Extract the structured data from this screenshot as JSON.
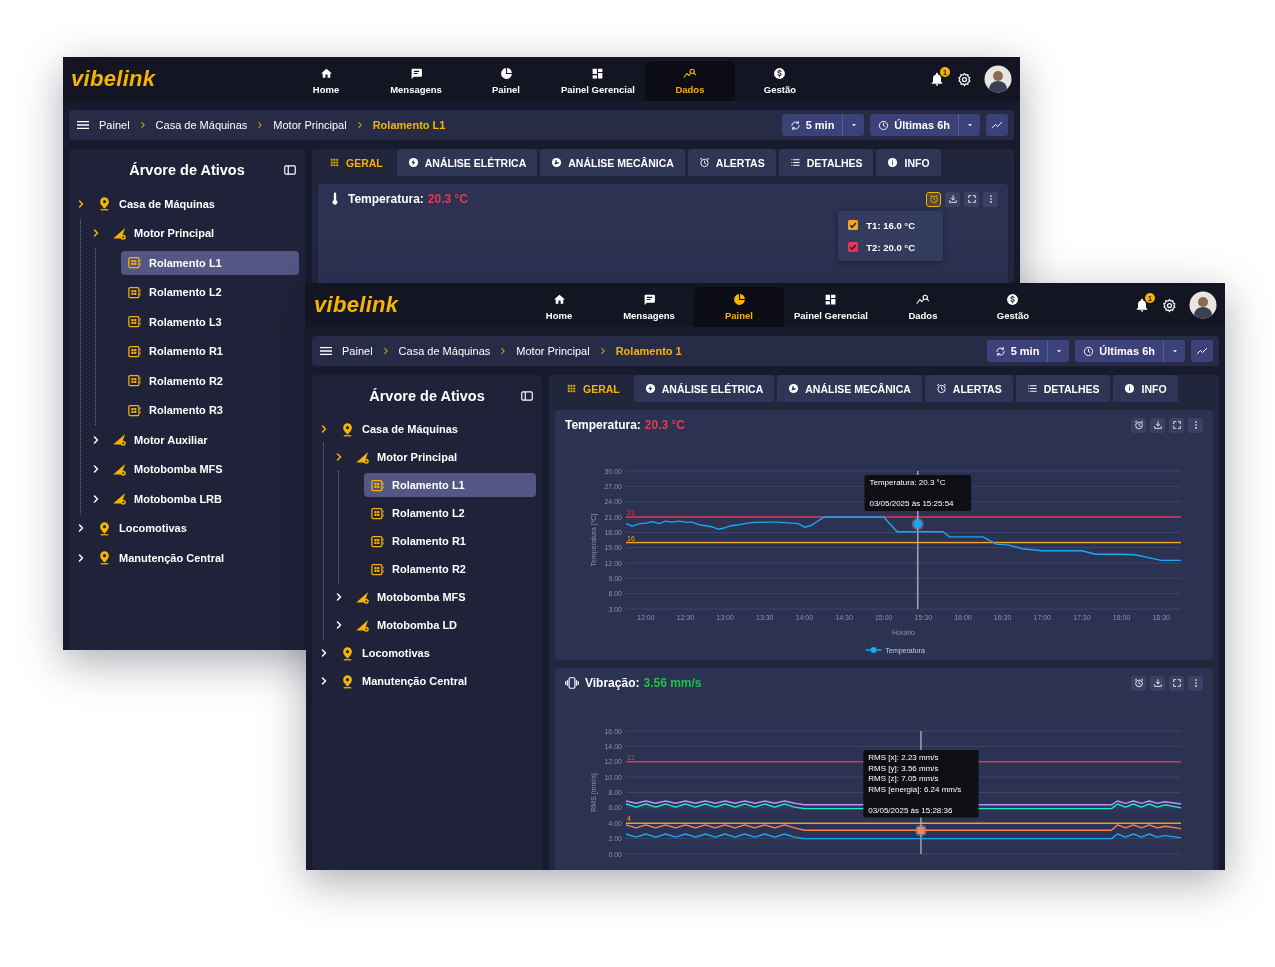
{
  "windows": [
    {
      "logo": "vibelink",
      "nav": [
        {
          "label": "Home",
          "selected": false
        },
        {
          "label": "Mensagens",
          "selected": false
        },
        {
          "label": "Painel",
          "selected": false
        },
        {
          "label": "Painel Gerencial",
          "selected": false
        },
        {
          "label": "Dados",
          "selected": true
        },
        {
          "label": "Gestão",
          "selected": false
        }
      ],
      "notification_count": "1",
      "breadcrumb": [
        "Painel",
        "Casa de Máquinas",
        "Motor Principal",
        "Rolamento L1"
      ],
      "refresh": "5 min",
      "range": "Últimas 6h",
      "sidebar": {
        "title": "Árvore de Ativos",
        "tree": [
          {
            "label": "Casa de Máquinas",
            "kind": "location",
            "selected": false,
            "expanded": true,
            "children": [
              {
                "label": "Motor Principal",
                "kind": "machine",
                "selected": false,
                "expanded": true,
                "children": [
                  {
                    "label": "Rolamento L1",
                    "kind": "bearing",
                    "selected": true
                  },
                  {
                    "label": "Rolamento L2",
                    "kind": "bearing",
                    "selected": false
                  },
                  {
                    "label": "Rolamento L3",
                    "kind": "bearing",
                    "selected": false
                  },
                  {
                    "label": "Rolamento R1",
                    "kind": "bearing",
                    "selected": false
                  },
                  {
                    "label": "Rolamento R2",
                    "kind": "bearing",
                    "selected": false
                  },
                  {
                    "label": "Rolamento R3",
                    "kind": "bearing",
                    "selected": false
                  }
                ]
              },
              {
                "label": "Motor Auxiliar",
                "kind": "machine",
                "selected": false,
                "expanded": false
              },
              {
                "label": "Motobomba MFS",
                "kind": "machine",
                "selected": false,
                "expanded": false
              },
              {
                "label": "Motobomba LRB",
                "kind": "machine",
                "selected": false,
                "expanded": false
              }
            ]
          },
          {
            "label": "Locomotivas",
            "kind": "location",
            "selected": false,
            "expanded": false
          },
          {
            "label": "Manutenção Central",
            "kind": "location",
            "selected": false,
            "expanded": false
          }
        ]
      },
      "tabs": [
        {
          "label": "GERAL",
          "selected": true
        },
        {
          "label": "ANÁLISE ELÉTRICA",
          "selected": false
        },
        {
          "label": "ANÁLISE MECÂNICA",
          "selected": false
        },
        {
          "label": "ALERTAS",
          "selected": false
        },
        {
          "label": "DETALHES",
          "selected": false
        },
        {
          "label": "INFO",
          "selected": false
        }
      ],
      "cards": [
        {
          "kind": "temperature",
          "title": "Temperatura:",
          "value": "20.3 °C",
          "color": "#e8374f",
          "threshold_menu": [
            {
              "label": "T1: 16.0 °C",
              "checked": true,
              "color": "#f5a623"
            },
            {
              "label": "T2: 20.0 °C",
              "checked": true,
              "color": "#e8374f"
            }
          ]
        }
      ]
    },
    {
      "logo": "vibelink",
      "nav": [
        {
          "label": "Home",
          "selected": false
        },
        {
          "label": "Mensagens",
          "selected": false
        },
        {
          "label": "Painel",
          "selected": true
        },
        {
          "label": "Painel Gerencial",
          "selected": false
        },
        {
          "label": "Dados",
          "selected": false
        },
        {
          "label": "Gestão",
          "selected": false
        }
      ],
      "notification_count": "1",
      "breadcrumb": [
        "Painel",
        "Casa de Máquinas",
        "Motor Principal",
        "Rolamento 1"
      ],
      "refresh": "5 min",
      "range": "Últimas 6h",
      "sidebar": {
        "title": "Árvore de Ativos",
        "tree": [
          {
            "label": "Casa de Máquinas",
            "kind": "location",
            "selected": false,
            "expanded": true,
            "children": [
              {
                "label": "Motor Principal",
                "kind": "machine",
                "selected": false,
                "expanded": true,
                "children": [
                  {
                    "label": "Rolamento L1",
                    "kind": "bearing",
                    "selected": true
                  },
                  {
                    "label": "Rolamento L2",
                    "kind": "bearing",
                    "selected": false
                  },
                  {
                    "label": "Rolamento R1",
                    "kind": "bearing",
                    "selected": false
                  },
                  {
                    "label": "Rolamento R2",
                    "kind": "bearing",
                    "selected": false
                  }
                ]
              },
              {
                "label": "Motobomba MFS",
                "kind": "machine",
                "selected": false,
                "expanded": false
              },
              {
                "label": "Motobomba LD",
                "kind": "machine",
                "selected": false,
                "expanded": false
              }
            ]
          },
          {
            "label": "Locomotivas",
            "kind": "location",
            "selected": false,
            "expanded": false
          },
          {
            "label": "Manutenção Central",
            "kind": "location",
            "selected": false,
            "expanded": false
          }
        ]
      },
      "tabs": [
        {
          "label": "GERAL",
          "selected": true
        },
        {
          "label": "ANÁLISE ELÉTRICA",
          "selected": false
        },
        {
          "label": "ANÁLISE MECÂNICA",
          "selected": false
        },
        {
          "label": "ALERTAS",
          "selected": false
        },
        {
          "label": "DETALHES",
          "selected": false
        },
        {
          "label": "INFO",
          "selected": false
        }
      ],
      "cards": [
        {
          "title": "Temperatura:",
          "value": "20.3 °C",
          "color": "#e8374f",
          "legend": true,
          "chart_data": {
            "type": "line",
            "xlabel": "Horário",
            "ylabel": "Temperatura [ºC]",
            "xlim": [
              11.75,
              18.75
            ],
            "ylim": [
              3,
              30
            ],
            "grid": true,
            "x": [
              11.75,
              11.83,
              11.92,
              12.0,
              12.08,
              12.17,
              12.25,
              12.33,
              12.42,
              12.5,
              12.58,
              12.67,
              12.75,
              12.83,
              12.92,
              13.0,
              13.08,
              13.17,
              13.25,
              13.33,
              13.5,
              13.67,
              13.83,
              13.92,
              14.0,
              14.08,
              14.25,
              15.0,
              15.17,
              15.75,
              15.83,
              16.25,
              16.42,
              16.58,
              16.75,
              17.0,
              17.5,
              17.67,
              18.0,
              18.17,
              18.5,
              18.75
            ],
            "series": [
              {
                "name": "Temperatura",
                "color": "#1ea7f0",
                "values": [
                  19.7,
                  19.2,
                  19.7,
                  19.8,
                  20.1,
                  19.7,
                  20.2,
                  20.0,
                  20.2,
                  20.0,
                  20.0,
                  19.5,
                  19.3,
                  19.1,
                  18.6,
                  18.9,
                  19.3,
                  19.5,
                  19.7,
                  19.9,
                  20.0,
                  20.0,
                  19.8,
                  19.7,
                  19.0,
                  19.3,
                  21.0,
                  21.0,
                  18.1,
                  18.1,
                  17.1,
                  17.1,
                  15.7,
                  15.5,
                  14.8,
                  14.4,
                  14.4,
                  13.7,
                  13.7,
                  13.6,
                  12.5,
                  12.5
                ]
              }
            ],
            "xticks": [
              {
                "value": 12,
                "label": "12:00"
              },
              {
                "value": 12.5,
                "label": "12:30"
              },
              {
                "value": 13,
                "label": "13:00"
              },
              {
                "value": 13.5,
                "label": "13:30"
              },
              {
                "value": 14,
                "label": "14:00"
              },
              {
                "value": 14.5,
                "label": "14:30"
              },
              {
                "value": 15,
                "label": "15:00"
              },
              {
                "value": 15.5,
                "label": "15:30"
              },
              {
                "value": 16,
                "label": "16:00"
              },
              {
                "value": 16.5,
                "label": "16:30"
              },
              {
                "value": 17,
                "label": "17:00"
              },
              {
                "value": 17.5,
                "label": "17:30"
              },
              {
                "value": 18,
                "label": "18:00"
              },
              {
                "value": 18.5,
                "label": "18:30"
              }
            ],
            "yticks": [
              {
                "value": 3,
                "label": "3.00"
              },
              {
                "value": 6,
                "label": "6.00"
              },
              {
                "value": 9,
                "label": "9.00"
              },
              {
                "value": 12,
                "label": "12.00"
              },
              {
                "value": 15,
                "label": "15.00"
              },
              {
                "value": 18,
                "label": "18.00"
              },
              {
                "value": 21,
                "label": "21.00"
              },
              {
                "value": 24,
                "label": "24.00"
              },
              {
                "value": 27,
                "label": "27.00"
              },
              {
                "value": 30,
                "label": "30.00"
              }
            ],
            "ref_lines": [
              {
                "axis": "y",
                "value": 21,
                "label": "21",
                "color": "#e8374f"
              },
              {
                "axis": "y",
                "value": 16,
                "label": "16",
                "color": "#f5a623"
              },
              {
                "axis": "x",
                "value": 15.43,
                "color": "#b8bdd0"
              }
            ],
            "annotations": [
              "Temperatura: 20.3 °C",
              "03/05/2025 às 15:25:54"
            ]
          }
        },
        {
          "kind": "vibration",
          "title": "Vibração:",
          "value": "3.56 mm/s",
          "color": "#1fbf4a",
          "chart_data": {
            "type": "line",
            "ylabel": "RMS [mm/s]",
            "xlim": [
              11.75,
              18.75
            ],
            "ylim": [
              0,
              16
            ],
            "grid": true,
            "x": [
              11.75,
              11.875,
              12.0,
              12.125,
              12.25,
              12.375,
              12.5,
              12.625,
              12.75,
              12.875,
              13.0,
              13.125,
              13.25,
              13.375,
              13.5,
              13.625,
              13.75,
              13.875,
              14.0,
              17.875,
              17.95,
              18.05,
              18.15,
              18.25,
              18.35,
              18.45,
              18.55,
              18.75
            ],
            "series": [
              {
                "color": "#1ea7f0",
                "values": [
                  2.6,
                  2.2,
                  2.6,
                  2.2,
                  2.6,
                  2.2,
                  2.6,
                  2.2,
                  2.6,
                  2.2,
                  2.6,
                  2.2,
                  2.6,
                  2.2,
                  2.6,
                  2.2,
                  2.6,
                  2.2,
                  2.0,
                  2.0,
                  2.6,
                  2.2,
                  2.6,
                  2.2,
                  2.6,
                  2.2,
                  2.4,
                  2.1
                ]
              },
              {
                "color": "#ff7f50",
                "values": [
                  3.8,
                  3.4,
                  3.8,
                  3.4,
                  3.8,
                  3.4,
                  3.8,
                  3.4,
                  3.8,
                  3.4,
                  3.8,
                  3.4,
                  3.8,
                  3.4,
                  3.8,
                  3.4,
                  3.8,
                  3.4,
                  3.1,
                  3.1,
                  3.8,
                  3.4,
                  3.8,
                  3.4,
                  3.8,
                  3.4,
                  3.6,
                  3.3
                ]
              },
              {
                "color": "#1de9c8",
                "values": [
                  6.5,
                  6.1,
                  6.5,
                  6.1,
                  6.5,
                  6.1,
                  6.5,
                  6.1,
                  6.5,
                  6.1,
                  6.5,
                  6.1,
                  6.5,
                  6.1,
                  6.5,
                  6.1,
                  6.5,
                  6.1,
                  5.9,
                  5.9,
                  6.5,
                  6.1,
                  6.5,
                  6.1,
                  6.5,
                  6.1,
                  6.4,
                  6.0
                ]
              },
              {
                "color": "#b891ff",
                "values": [
                  6.9,
                  6.6,
                  6.9,
                  6.6,
                  6.9,
                  6.6,
                  6.9,
                  6.6,
                  6.9,
                  6.6,
                  6.9,
                  6.6,
                  6.9,
                  6.6,
                  6.9,
                  6.6,
                  6.9,
                  6.6,
                  6.4,
                  6.4,
                  6.9,
                  6.6,
                  6.9,
                  6.6,
                  6.9,
                  6.6,
                  6.8,
                  6.5
                ]
              }
            ],
            "yticks": [
              {
                "value": 0,
                "label": "0.00"
              },
              {
                "value": 2,
                "label": "2.00"
              },
              {
                "value": 4,
                "label": "4.00"
              },
              {
                "value": 6,
                "label": "6.00"
              },
              {
                "value": 8,
                "label": "8.00"
              },
              {
                "value": 10,
                "label": "10.00"
              },
              {
                "value": 12,
                "label": "12.00"
              },
              {
                "value": 14,
                "label": "14.00"
              },
              {
                "value": 16,
                "label": "16.00"
              }
            ],
            "ref_lines": [
              {
                "axis": "y",
                "value": 12,
                "label": "12",
                "color": "#e8374f"
              },
              {
                "axis": "y",
                "value": 4,
                "label": "4",
                "color": "#f5a623"
              },
              {
                "axis": "x",
                "value": 15.47,
                "color": "#b8bdd0"
              }
            ],
            "annotations": [
              "RMS [x]: 2.23 mm/s",
              "RMS [y]: 3.56 mm/s",
              "RMS [z]: 7.05 mm/s",
              "RMS [energia]: 6.24 mm/s",
              "03/05/2025 às 15:28:36"
            ]
          }
        }
      ]
    }
  ]
}
